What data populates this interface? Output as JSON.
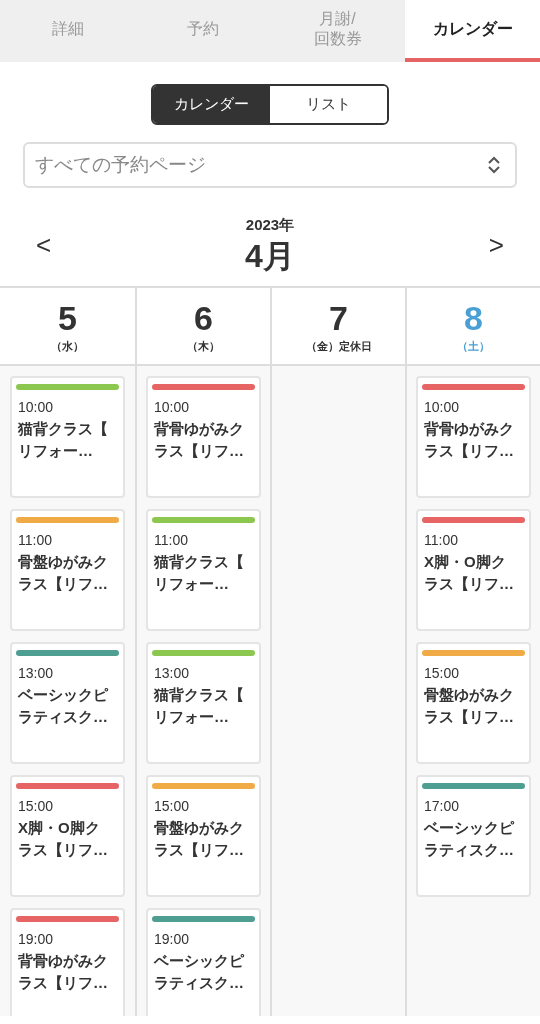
{
  "tabs": [
    {
      "label": "詳細",
      "selected": false
    },
    {
      "label": "予約",
      "selected": false
    },
    {
      "label": "月謝/\n回数券",
      "selected": false
    },
    {
      "label": "カレンダー",
      "selected": true
    }
  ],
  "view_toggle": [
    {
      "label": "カレンダー",
      "selected": true
    },
    {
      "label": "リスト",
      "selected": false
    }
  ],
  "page_select": {
    "placeholder": "すべての予約ページ"
  },
  "month_nav": {
    "prev": "<",
    "year": "2023年",
    "month": "4月",
    "next": ">"
  },
  "days": [
    {
      "date": "5",
      "weekday": "（水）",
      "saturday": false,
      "events": [
        {
          "time": "10:00",
          "title": "猫背クラス【リフォー…",
          "color": "#8cc850"
        },
        {
          "time": "11:00",
          "title": "骨盤ゆがみクラス【リフ…",
          "color": "#f0aa46"
        },
        {
          "time": "13:00",
          "title": "ベーシックピラティスク…",
          "color": "#4f9e92"
        },
        {
          "time": "15:00",
          "title": "X脚・O脚クラス【リフ…",
          "color": "#e66464"
        },
        {
          "time": "19:00",
          "title": "背骨ゆがみクラス【リフ…",
          "color": "#e66464"
        }
      ]
    },
    {
      "date": "6",
      "weekday": "（木）",
      "saturday": false,
      "events": [
        {
          "time": "10:00",
          "title": "背骨ゆがみクラス【リフ…",
          "color": "#e66464"
        },
        {
          "time": "11:00",
          "title": "猫背クラス【リフォー…",
          "color": "#8cc850"
        },
        {
          "time": "13:00",
          "title": "猫背クラス【リフォー…",
          "color": "#8cc850"
        },
        {
          "time": "15:00",
          "title": "骨盤ゆがみクラス【リフ…",
          "color": "#f0aa46"
        },
        {
          "time": "19:00",
          "title": "ベーシックピラティスク…",
          "color": "#4f9e92"
        }
      ]
    },
    {
      "date": "7",
      "weekday": "（金）",
      "note": "定休日",
      "saturday": false
    },
    {
      "date": "8",
      "weekday": "（土）",
      "saturday": true,
      "events": [
        {
          "time": "10:00",
          "title": "背骨ゆがみクラス【リフ…",
          "color": "#e66464"
        },
        {
          "time": "11:00",
          "title": "X脚・O脚クラス【リフ…",
          "color": "#e66464"
        },
        {
          "time": "15:00",
          "title": "骨盤ゆがみクラス【リフ…",
          "color": "#f0aa46"
        },
        {
          "time": "17:00",
          "title": "ベーシックピラティスク…",
          "color": "#4f9e92"
        }
      ]
    }
  ]
}
